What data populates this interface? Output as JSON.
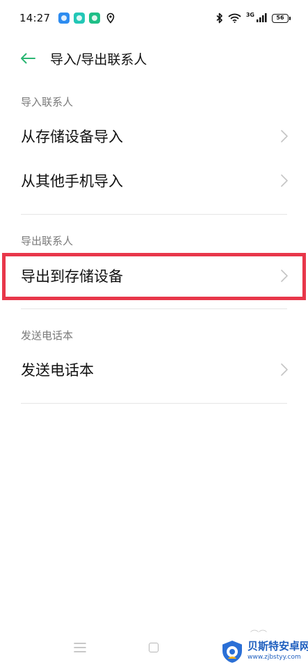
{
  "status_bar": {
    "time": "14:27",
    "network_label": "3G",
    "battery_level": "56",
    "icons": [
      "notification-app-icon",
      "notification-app-icon",
      "notification-app-icon",
      "location-icon",
      "bluetooth-icon",
      "wifi-icon",
      "signal-icon",
      "battery-icon"
    ]
  },
  "header": {
    "title": "导入/导出联系人",
    "back_icon": "back-arrow-icon",
    "accent_color": "#2bb673"
  },
  "sections": {
    "import": {
      "label": "导入联系人",
      "items": [
        {
          "label": "从存储设备导入"
        },
        {
          "label": "从其他手机导入"
        }
      ]
    },
    "export": {
      "label": "导出联系人",
      "items": [
        {
          "label": "导出到存储设备"
        }
      ]
    },
    "send": {
      "label": "发送电话本",
      "items": [
        {
          "label": "发送电话本"
        }
      ]
    }
  },
  "highlight_color": "#e8374a",
  "nav_bar": {
    "icons": [
      "menu-icon",
      "home-icon"
    ]
  },
  "watermark": {
    "title": "贝斯特安卓网",
    "url": "www.zjbstyy.com"
  }
}
